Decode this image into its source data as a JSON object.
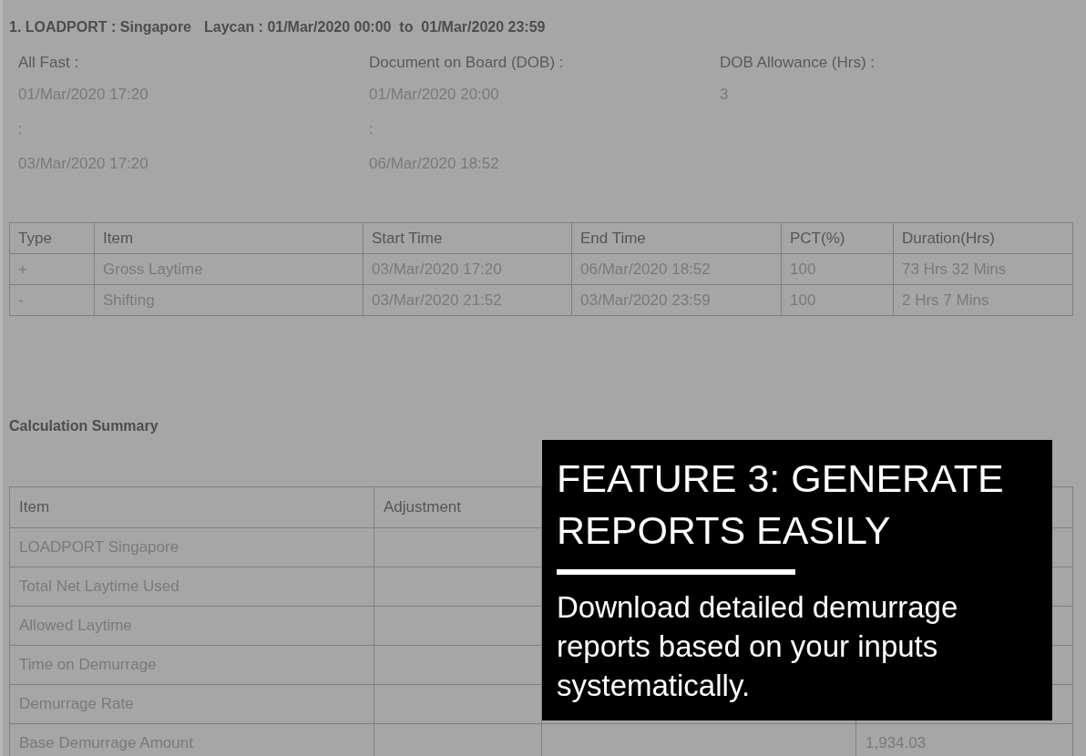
{
  "port_header": {
    "port": "1. LOADPORT : Singapore",
    "laycan": "Laycan : 01/Mar/2020 00:00  to  01/Mar/2020 23:59"
  },
  "fields": [
    {
      "label": "All Fast :",
      "values": [
        "01/Mar/2020 17:20",
        ":",
        "03/Mar/2020 17:20"
      ]
    },
    {
      "label": "Document on Board (DOB) :",
      "values": [
        "01/Mar/2020 20:00",
        ":",
        "06/Mar/2020 18:52"
      ]
    },
    {
      "label": "DOB Allowance (Hrs) :",
      "values": [
        "3"
      ]
    }
  ],
  "time_table": {
    "columns": [
      "Type",
      "Item",
      "Start Time",
      "End Time",
      "PCT(%)",
      "Duration(Hrs)"
    ],
    "rows": [
      [
        "+",
        "Gross Laytime",
        "03/Mar/2020 17:20",
        "06/Mar/2020 18:52",
        "100",
        "73 Hrs 32 Mins"
      ],
      [
        "-",
        "Shifting",
        "03/Mar/2020 21:52",
        "03/Mar/2020 23:59",
        "100",
        "2 Hrs 7 Mins"
      ]
    ]
  },
  "summary": {
    "title": "Calculation Summary",
    "columns": [
      "Item",
      "Adjustment"
    ],
    "rows": [
      [
        "LOADPORT Singapore",
        "",
        "",
        ""
      ],
      [
        "Total Net Laytime Used",
        "",
        "",
        ""
      ],
      [
        "Allowed Laytime",
        "",
        "",
        ""
      ],
      [
        "Time on Demurrage",
        "",
        "",
        ""
      ],
      [
        "Demurrage Rate",
        "",
        "",
        ""
      ],
      [
        "Base Demurrage Amount",
        "",
        "",
        "1,934.03"
      ]
    ]
  },
  "overlay": {
    "heading": "FEATURE 3: GENERATE REPORTS EASILY",
    "body": "Download detailed demurrage reports based on your inputs systematically."
  }
}
